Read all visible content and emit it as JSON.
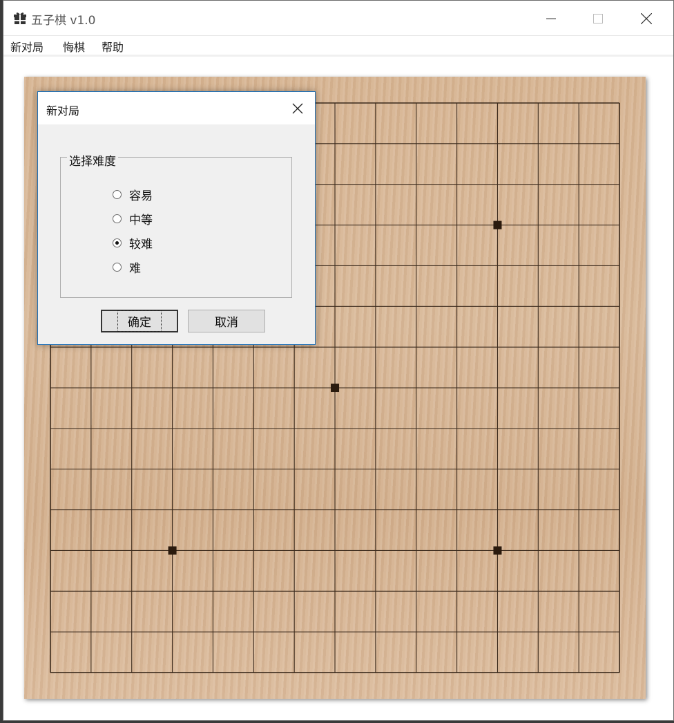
{
  "window": {
    "title": "五子棋 v1.0",
    "icon": "gift-icon"
  },
  "menu": [
    "新对局",
    "悔棋",
    "帮助"
  ],
  "board": {
    "lines": 15,
    "star_points": [
      [
        11,
        3
      ],
      [
        7,
        7
      ],
      [
        3,
        11
      ],
      [
        11,
        11
      ]
    ],
    "line_color": "#3b2a1c",
    "wood_color": "#d8b897"
  },
  "dialog": {
    "title": "新对局",
    "group_label": "选择难度",
    "options": [
      {
        "label": "容易",
        "checked": false
      },
      {
        "label": "中等",
        "checked": false
      },
      {
        "label": "较难",
        "checked": true
      },
      {
        "label": "难",
        "checked": false
      }
    ],
    "ok_label": "确定",
    "cancel_label": "取消"
  }
}
